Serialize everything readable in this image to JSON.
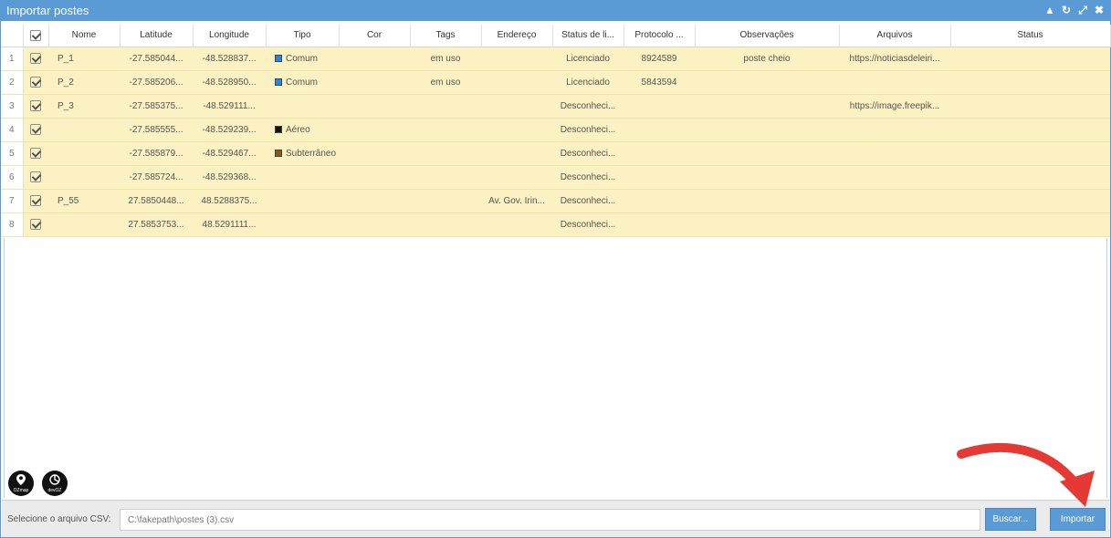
{
  "window": {
    "title": "Importar postes"
  },
  "title_controls": [
    "▲",
    "↻",
    "⤢",
    "✖"
  ],
  "columns": [
    "Nome",
    "Latitude",
    "Longitude",
    "Tipo",
    "Cor",
    "Tags",
    "Endereço",
    "Status de li...",
    "Protocolo ...",
    "Observações",
    "Arquivos",
    "Status"
  ],
  "rows": [
    {
      "num": "1",
      "nome": "P_1",
      "lat": "-27.585044...",
      "lon": "-48.528837...",
      "tipo": "Comum",
      "tipo_color": "#1e88e5",
      "cor": "",
      "tags": "em uso",
      "endereco": "",
      "status_li": "Licenciado",
      "protocolo": "8924589",
      "obs": "poste cheio",
      "arquivos": "https://noticiasdeleiri...",
      "status": ""
    },
    {
      "num": "2",
      "nome": "P_2",
      "lat": "-27.585206...",
      "lon": "-48.528950...",
      "tipo": "Comum",
      "tipo_color": "#1e88e5",
      "cor": "",
      "tags": "em uso",
      "endereco": "",
      "status_li": "Licenciado",
      "protocolo": "5843594",
      "obs": "",
      "arquivos": "",
      "status": ""
    },
    {
      "num": "3",
      "nome": "P_3",
      "lat": "-27.585375...",
      "lon": "-48.529111...",
      "tipo": "",
      "tipo_color": "",
      "cor": "",
      "tags": "",
      "endereco": "",
      "status_li": "Desconheci...",
      "protocolo": "",
      "obs": "",
      "arquivos": "https://image.freepik...",
      "status": ""
    },
    {
      "num": "4",
      "nome": "",
      "lat": "-27.585555...",
      "lon": "-48.529239...",
      "tipo": "Aéreo",
      "tipo_color": "#111111",
      "cor": "",
      "tags": "",
      "endereco": "",
      "status_li": "Desconheci...",
      "protocolo": "",
      "obs": "",
      "arquivos": "",
      "status": ""
    },
    {
      "num": "5",
      "nome": "",
      "lat": "-27.585879...",
      "lon": "-48.529467...",
      "tipo": "Subterrâneo",
      "tipo_color": "#8b5a1a",
      "cor": "",
      "tags": "",
      "endereco": "",
      "status_li": "Desconheci...",
      "protocolo": "",
      "obs": "",
      "arquivos": "",
      "status": ""
    },
    {
      "num": "6",
      "nome": "",
      "lat": "-27.585724...",
      "lon": "-48.529368...",
      "tipo": "",
      "tipo_color": "",
      "cor": "",
      "tags": "",
      "endereco": "",
      "status_li": "Desconheci...",
      "protocolo": "",
      "obs": "",
      "arquivos": "",
      "status": ""
    },
    {
      "num": "7",
      "nome": "P_55",
      "lat": "27.5850448...",
      "lon": "48.5288375...",
      "tipo": "",
      "tipo_color": "",
      "cor": "",
      "tags": "",
      "endereco": "Av. Gov. Irin...",
      "status_li": "Desconheci...",
      "protocolo": "",
      "obs": "",
      "arquivos": "",
      "status": ""
    },
    {
      "num": "8",
      "nome": "",
      "lat": "27.5853753...",
      "lon": "48.5291111...",
      "tipo": "",
      "tipo_color": "",
      "cor": "",
      "tags": "",
      "endereco": "",
      "status_li": "Desconheci...",
      "protocolo": "",
      "obs": "",
      "arquivos": "",
      "status": ""
    }
  ],
  "logos": {
    "ozmap": "OZmap",
    "devoz": "devOZ"
  },
  "footer": {
    "label": "Selecione o arquivo CSV:",
    "file_path": "C:\\fakepath\\postes (3).csv",
    "buscar": "Buscar...",
    "importar": "Importar"
  },
  "colors": {
    "accent": "#5b9bd5",
    "row_highlight": "#fcf1c2",
    "annotation_arrow": "#e53935"
  }
}
